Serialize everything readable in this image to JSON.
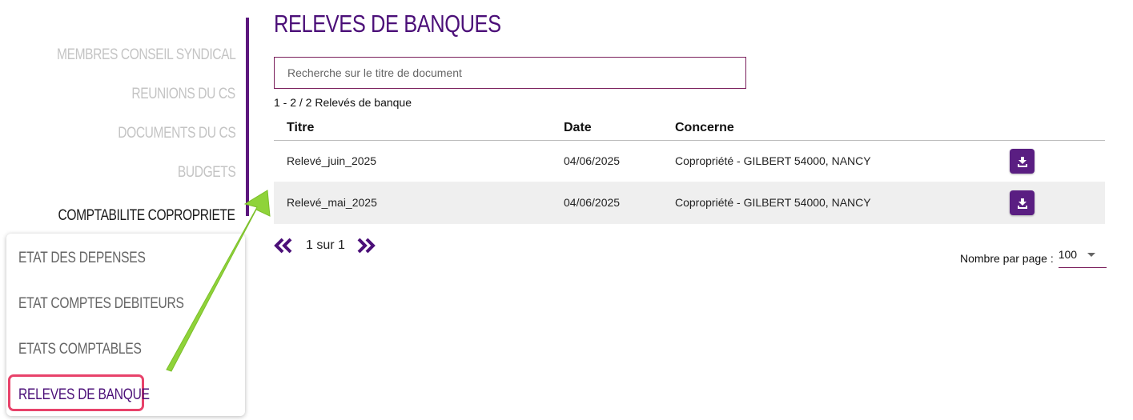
{
  "nav": {
    "items": [
      {
        "label": "MEMBRES CONSEIL SYNDICAL"
      },
      {
        "label": "REUNIONS DU CS"
      },
      {
        "label": "DOCUMENTS DU CS"
      },
      {
        "label": "BUDGETS"
      },
      {
        "label": "COMPTABILITE COPROPRIETE"
      }
    ],
    "submenu": [
      {
        "label": "ETAT DES DEPENSES"
      },
      {
        "label": "ETAT COMPTES DEBITEURS"
      },
      {
        "label": "ETATS COMPTABLES"
      },
      {
        "label": "RELEVES DE BANQUE"
      }
    ]
  },
  "page": {
    "title": "RELEVES DE BANQUES",
    "search_placeholder": "Recherche sur le titre de document",
    "search_value": "",
    "count": "1 - 2 / 2 Relevés de banque"
  },
  "table": {
    "headers": {
      "title": "Titre",
      "date": "Date",
      "concerne": "Concerne"
    },
    "rows": [
      {
        "title": "Relevé_juin_2025",
        "date": "04/06/2025",
        "concerne": "Copropriété - GILBERT 54000, NANCY"
      },
      {
        "title": "Relevé_mai_2025",
        "date": "04/06/2025",
        "concerne": "Copropriété - GILBERT 54000, NANCY"
      }
    ]
  },
  "pager": {
    "text": "1 sur 1"
  },
  "perpage": {
    "label": "Nombre par page :",
    "value": "100"
  },
  "colors": {
    "brand_purple": "#4b0f78",
    "button_purple": "#5a1e82",
    "highlight": "#e8426a",
    "arrow_green": "#8fd33a"
  },
  "icons": {
    "prev": "double-chevron-left-icon",
    "next": "double-chevron-right-icon",
    "download": "download-icon",
    "dropdown": "caret-down-icon"
  }
}
